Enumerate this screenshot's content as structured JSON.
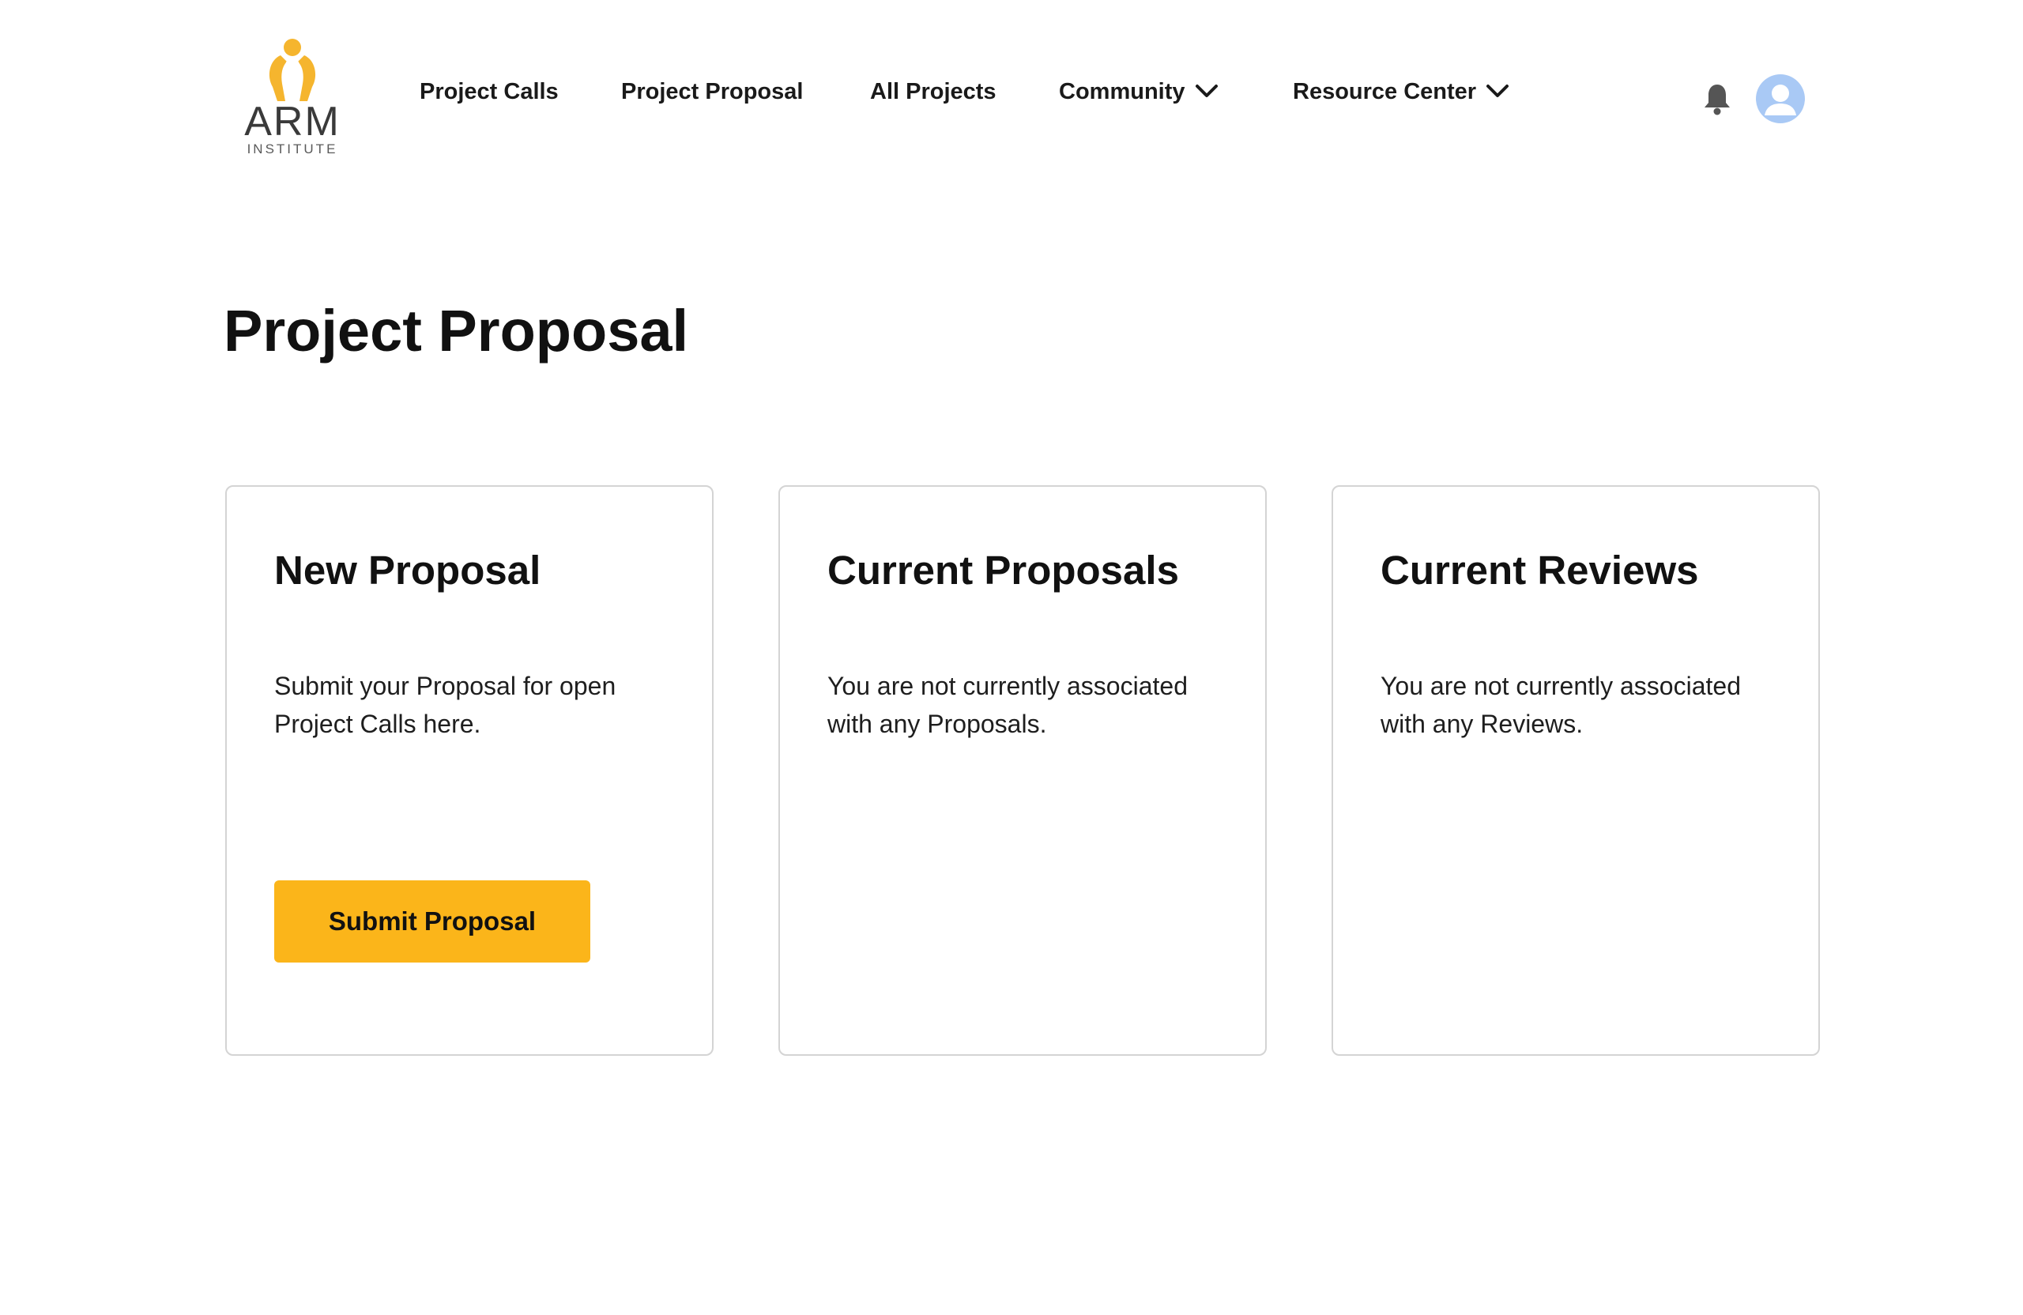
{
  "logo": {
    "wordmark": "ARM",
    "subtitle": "INSTITUTE",
    "accent_color": "#f5b52e"
  },
  "nav": {
    "items": [
      {
        "label": "Project Calls"
      },
      {
        "label": "Project Proposal"
      },
      {
        "label": "All Projects"
      },
      {
        "label": "Community",
        "icon": "chevron-down-icon"
      },
      {
        "label": "Resource Center",
        "icon": "chevron-down-icon"
      }
    ],
    "bell_icon": "bell-icon",
    "avatar_icon": "user-icon"
  },
  "page": {
    "title": "Project Proposal"
  },
  "cards": [
    {
      "title": "New Proposal",
      "text": "Submit your Proposal for open Project Calls here.",
      "button_label": "Submit Proposal"
    },
    {
      "title": "Current Proposals",
      "text": "You are not currently associated with any Proposals."
    },
    {
      "title": "Current Reviews",
      "text": "You are not currently associated with any Reviews."
    }
  ],
  "colors": {
    "button": "#fbb51a",
    "avatar": "#a9c9f5",
    "border": "#d4d4d4"
  }
}
